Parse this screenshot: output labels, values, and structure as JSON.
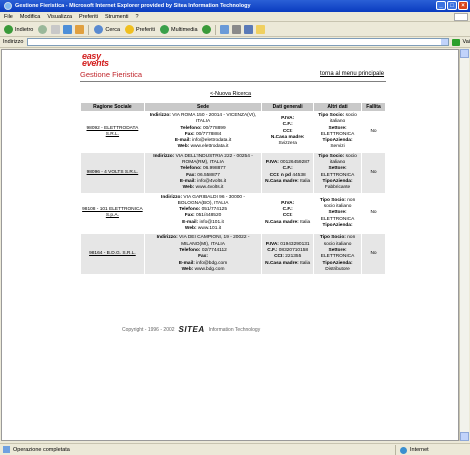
{
  "window": {
    "title": "Gestione Fieristica - Microsoft Internet Explorer provided by Sitea Information Technology"
  },
  "menu": [
    "File",
    "Modifica",
    "Visualizza",
    "Preferiti",
    "Strumenti",
    "?"
  ],
  "toolbar": {
    "back": "Indietro",
    "search": "Cerca",
    "favorites": "Preferiti",
    "media": "Multimedia"
  },
  "address": {
    "label": "Indirizzo",
    "value": "",
    "go": "Vai"
  },
  "page": {
    "logo_line1": "easy",
    "logo_line2": "events",
    "title": "Gestione Fieristica",
    "main_link": "torna al menu principale",
    "new_search": "<-Nuova Ricerca"
  },
  "table": {
    "headers": [
      "Ragione Sociale",
      "Sede",
      "Dati generali",
      "Altri dati",
      "Fallita"
    ],
    "rows": [
      {
        "ragione": "98092 - ELETTRODATA S.R.L.",
        "ind_label": "Indirizzo:",
        "ind": "VIA ROMA 150 - 20014 - VICENZA(VI), ITALIA",
        "tel_label": "Telefono:",
        "tel": "00/778899",
        "fax_label": "Fax:",
        "fax": "00/7778884",
        "email_label": "E-mail:",
        "email": "info@elettrodata.it",
        "web_label": "Web:",
        "web": "www.elettrodata.it",
        "piva_label": "P.IVA:",
        "piva": "",
        "cf_label": "C.F.:",
        "cf": "",
        "cci_label": "CCI:",
        "cci": "",
        "casa_label": "N.Casa madre:",
        "casa": "Svizzera",
        "socio_label": "Tipo Socio:",
        "socio": "socio italiano",
        "settore_label": "Settore:",
        "settore": "ELETTRONICA",
        "tipoaz_label": "TipoAzienda:",
        "tipoaz": "Servizi",
        "fallita": "No"
      },
      {
        "ragione": "98096 - 4 VOLTS S.R.L.",
        "ind_label": "Indirizzo:",
        "ind": "VIA DELL'INDUSTRIA 222 - 00254 - ROMA(RM), ITALIA",
        "tel_label": "Telefono:",
        "tel": "06.998877",
        "fax_label": "Fax:",
        "fax": "06.558877",
        "email_label": "E-mail:",
        "email": "info@4volts.it",
        "web_label": "Web:",
        "web": "www.4volts.it",
        "piva_label": "P.IVA:",
        "piva": "00126459287",
        "cf_label": "C.F.:",
        "cf": "",
        "cci_label": "CCI: n pd",
        "cci": "44538",
        "casa_label": "N.Casa madre:",
        "casa": "Italia",
        "socio_label": "Tipo Socio:",
        "socio": "socio italiano",
        "settore_label": "Settore:",
        "settore": "ELETTRONICA",
        "tipoaz_label": "TipoAzienda:",
        "tipoaz": "Fabbricante",
        "fallita": "No"
      },
      {
        "ragione": "98108 - 101 ELETTRONICA S.p.A.",
        "ind_label": "Indirizzo:",
        "ind": "VIA GARIBALDI 96 - 30000 - BOLOGNA(BO), ITALIA",
        "tel_label": "Telefono:",
        "tel": "051/774125",
        "fax_label": "Fax:",
        "fax": "051/448520",
        "email_label": "E-mail:",
        "email": "info@101.it",
        "web_label": "Web:",
        "web": "www.101.it",
        "piva_label": "P.IVA:",
        "piva": "",
        "cf_label": "C.F.:",
        "cf": "",
        "cci_label": "CCI:",
        "cci": "",
        "casa_label": "N.Casa madre:",
        "casa": "Italia",
        "socio_label": "Tipo Socio:",
        "socio": "non socio italiano",
        "settore_label": "Settore:",
        "settore": "ELETTRONICA",
        "tipoaz_label": "TipoAzienda:",
        "tipoaz": "",
        "fallita": "No"
      },
      {
        "ragione": "98164 - B.D.G. S.R.L.",
        "ind_label": "Indirizzo:",
        "ind": "VIA DEI CAMPIONI, 19 - 20022 - MILANO(MI), ITALIA",
        "tel_label": "Telefono:",
        "tel": "02/7744112",
        "fax_label": "Fax:",
        "fax": "",
        "email_label": "E-mail:",
        "email": "info@bdg.com",
        "web_label": "Web:",
        "web": "www.bdg.com",
        "piva_label": "P.IVA:",
        "piva": "01943290131",
        "cf_label": "C.F.:",
        "cf": "08320710158",
        "cci_label": "CCI:",
        "cci": "221355",
        "casa_label": "N.Casa madre:",
        "casa": "Italia",
        "socio_label": "Tipo Socio:",
        "socio": "non socio italiano",
        "settore_label": "Settore:",
        "settore": "ELETTRONICA",
        "tipoaz_label": "TipoAzienda:",
        "tipoaz": "Distributore",
        "fallita": "No"
      }
    ]
  },
  "footer": {
    "copyright": "Copyright - 1996 - 2002",
    "brand": "SITEA",
    "brand_sub": "Information Technology"
  },
  "status": {
    "text": "Operazione completata",
    "zone": "Internet"
  }
}
